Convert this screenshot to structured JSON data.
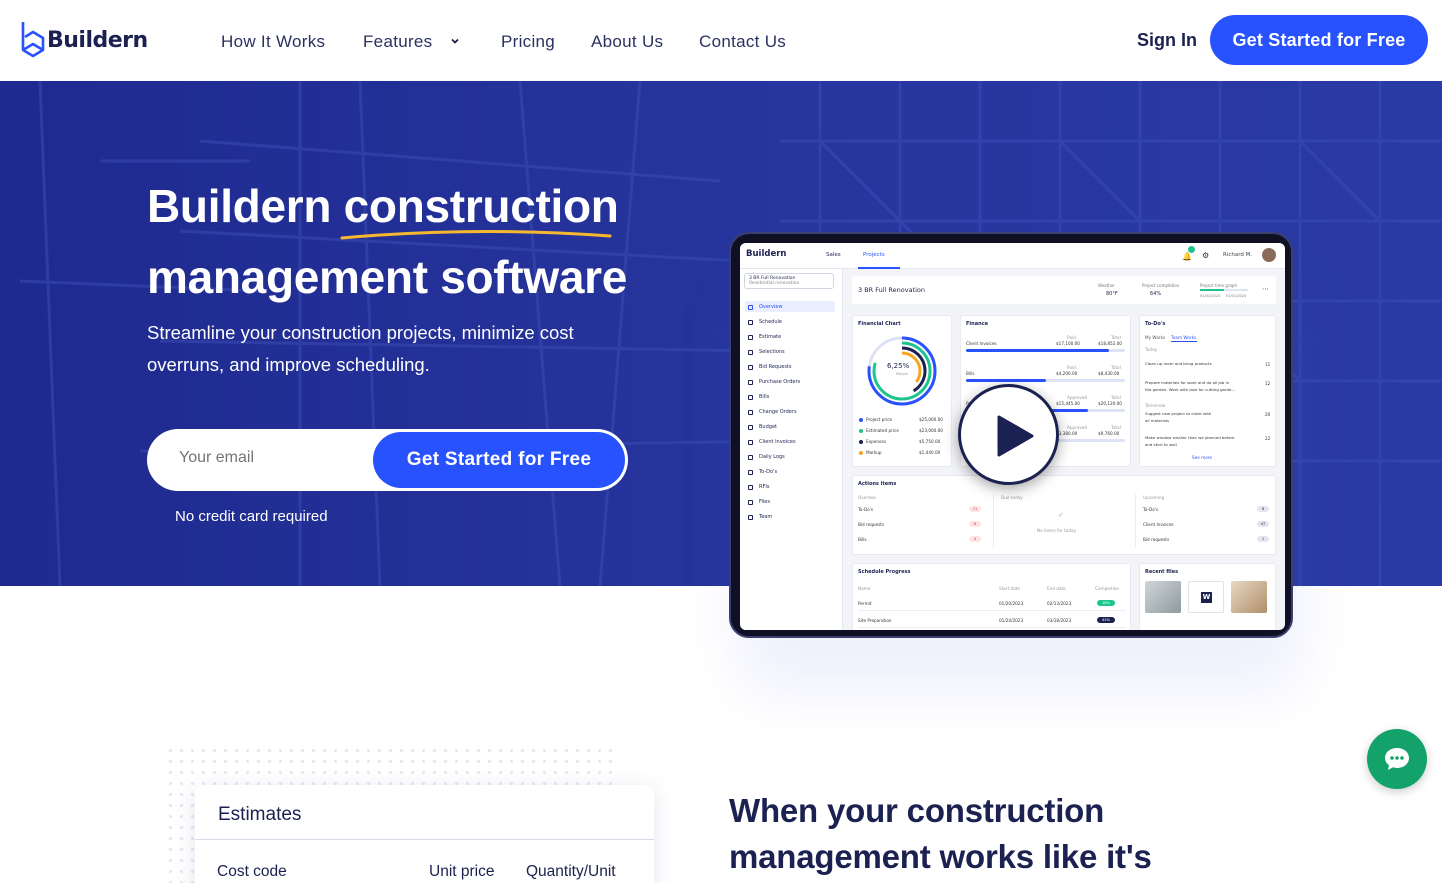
{
  "nav": {
    "logo_text": "Buildern",
    "links": [
      "How It Works",
      "Features",
      "Pricing",
      "About Us",
      "Contact Us"
    ],
    "sign_in": "Sign In",
    "cta": "Get Started for Free"
  },
  "hero": {
    "title_line1": "Buildern construction",
    "title_line2": "management software",
    "subtitle": "Streamline your construction projects, minimize cost overruns, and improve scheduling.",
    "email_placeholder": "Your email",
    "cta": "Get Started for Free",
    "note": "No credit card required"
  },
  "app": {
    "logo": "Buildern",
    "tabs": [
      "Sales",
      "Projects"
    ],
    "user": "Richard M.",
    "notif_count": "12",
    "project_name": "3 BR Full Renovation",
    "project_type": "Residential renovation",
    "sidebar": [
      "Overview",
      "Schedule",
      "Estimate",
      "Selections",
      "Bid Requests",
      "Purchase Orders",
      "Bills",
      "Change Orders",
      "Budget",
      "Client Invoices",
      "Daily Logs",
      "To-Do's",
      "RFIs",
      "Files",
      "Team"
    ],
    "header": {
      "title": "3 BR Full Renovation",
      "weather_label": "Weather",
      "weather_value": "80°F",
      "completion_label": "Project completion",
      "completion_value": "64%",
      "graph_label": "Project time graph",
      "graph_start": "01/01/2023",
      "graph_end": "01/01/2024"
    },
    "financial": {
      "title": "Financial Chart",
      "margin_value": "6,25%",
      "margin_label": "Margin",
      "rows": [
        {
          "label": "Project price",
          "value": "$25,000.00",
          "color": "#2952ff"
        },
        {
          "label": "Estimated price",
          "value": "$23,000.00",
          "color": "#1cc58b"
        },
        {
          "label": "Expenses",
          "value": "$5,750.00",
          "color": "#1b2150"
        },
        {
          "label": "Markup",
          "value": "$1,440.00",
          "color": "#f5a623"
        }
      ]
    },
    "finance": {
      "title": "Finance",
      "rows": [
        {
          "label": "Client Invoices",
          "k1": "Paid",
          "v1": "$17,100.00",
          "k2": "Total",
          "v2": "$18,852.00",
          "fill": 0.9
        },
        {
          "label": "Bills",
          "k1": "Paid",
          "v1": "$4,200.00",
          "k2": "Total",
          "v2": "$8,430.00",
          "fill": 0.5
        },
        {
          "label": "Purchase Orders",
          "k1": "Approved",
          "v1": "$15,445.00",
          "k2": "Total",
          "v2": "$20,120.00",
          "fill": 0.77
        },
        {
          "label": "Change Orders",
          "k1": "Approved",
          "v1": "$3,380.00",
          "k2": "Total",
          "v2": "$9,760.00",
          "fill": 0.35
        }
      ]
    },
    "todos": {
      "title": "To-Do's",
      "tabs": [
        "My Works",
        "Team Works"
      ],
      "today": "Today",
      "tomorrow": "Tomorrow",
      "items": [
        {
          "text": "Clean up room and bring products",
          "day": "11"
        },
        {
          "text": "Prepare materials for work and do all job in",
          "text2": "the garden. Work with Jose for cutting garde...",
          "day": "12"
        },
        {
          "text": "Suggest new project to client with",
          "text2": "all materials",
          "day": "20"
        },
        {
          "text": "Make window smaller than we planned before",
          "text2": "and stick to wall",
          "day": "22"
        }
      ],
      "see_more": "See more"
    },
    "actions": {
      "title": "Actions items",
      "overdue": "Overdue",
      "due_today": "Due today",
      "upcoming": "Upcoming",
      "overdue_items": [
        {
          "label": "To-Do's",
          "count": "11"
        },
        {
          "label": "Bid requests",
          "count": "6"
        },
        {
          "label": "Bills",
          "count": "4"
        }
      ],
      "empty": "No items for today",
      "upcoming_items": [
        {
          "label": "To-Do's",
          "count": "8"
        },
        {
          "label": "Client Invoices",
          "count": "47"
        },
        {
          "label": "Bid requests",
          "count": "1"
        }
      ]
    },
    "schedule": {
      "title": "Schedule Progress",
      "cols": [
        "Name",
        "Start date",
        "End date",
        "Completion"
      ],
      "rows": [
        {
          "name": "Permit",
          "start": "01/20/2023",
          "end": "02/13/2023",
          "pct": "18%",
          "color": "#1cc58b"
        },
        {
          "name": "Site Preparation",
          "start": "01/24/2023",
          "end": "03/18/2023",
          "pct": "43%",
          "color": "#1b2150"
        }
      ]
    },
    "files": {
      "title": "Recent files"
    }
  },
  "estimates": {
    "title": "Estimates",
    "columns": [
      "Cost code",
      "Unit price",
      "Quantity/Unit"
    ]
  },
  "lower": {
    "heading_line1": "When your construction",
    "heading_line2": "management works like it's"
  }
}
